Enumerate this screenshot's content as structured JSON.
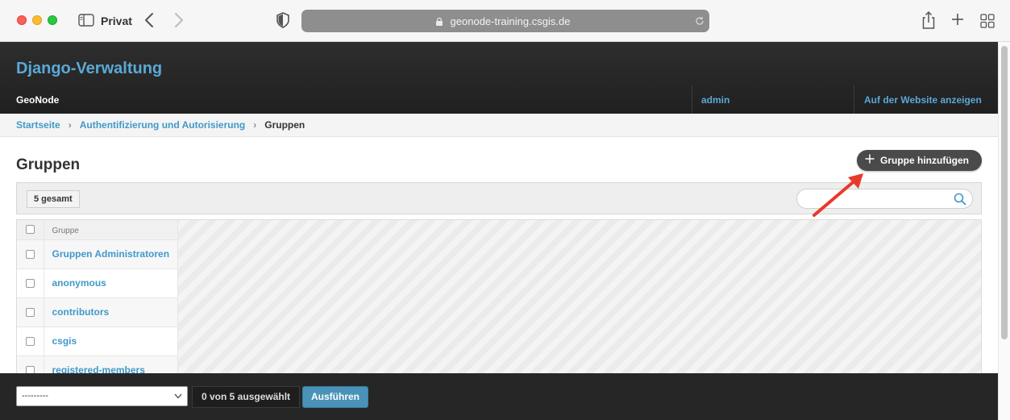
{
  "browser": {
    "profile_label": "Privat",
    "url": "geonode-training.csgis.de"
  },
  "header": {
    "site_name": "Django-Verwaltung",
    "brand": "GeoNode",
    "user_link": "admin",
    "site_link": "Auf der Website anzeigen"
  },
  "breadcrumbs": {
    "home": "Startseite",
    "app": "Authentifizierung und Autorisierung",
    "current": "Gruppen"
  },
  "main": {
    "title": "Gruppen",
    "add_button": "Gruppe hinzufügen",
    "total_count": "5 gesamt",
    "search": {
      "value": ""
    }
  },
  "table": {
    "column_header": "Gruppe",
    "rows": [
      "Gruppen Administratoren",
      "anonymous",
      "contributors",
      "csgis",
      "registered-members"
    ]
  },
  "actions": {
    "select_value": "---------",
    "selected_count": "0 von 5 ausgewählt",
    "run_button": "Ausführen"
  },
  "colors": {
    "accent": "#5aa9d6",
    "link": "#4199c9",
    "header_bg": "#262626",
    "annotation_arrow": "#e8392a"
  }
}
